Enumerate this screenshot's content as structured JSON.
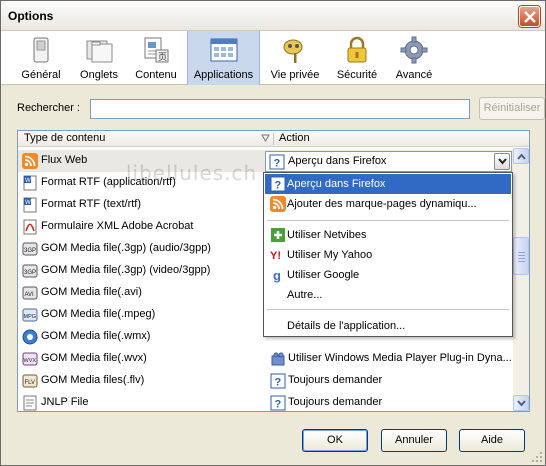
{
  "window": {
    "title": "Options"
  },
  "colors": {
    "selected_tab": "#c9d7ec",
    "highlight": "#316ac5",
    "xp_border": "#003c74"
  },
  "toolbar": {
    "tabs": [
      {
        "label": "Général",
        "icon": "switch-icon"
      },
      {
        "label": "Onglets",
        "icon": "folders-icon"
      },
      {
        "label": "Contenu",
        "icon": "content-page-icon"
      },
      {
        "label": "Applications",
        "icon": "applications-window-icon",
        "selected": true
      },
      {
        "label": "Vie privée",
        "icon": "privacy-mask-icon"
      },
      {
        "label": "Sécurité",
        "icon": "padlock-icon"
      },
      {
        "label": "Avancé",
        "icon": "gear-icon"
      }
    ]
  },
  "search": {
    "label": "Rechercher :",
    "value": "",
    "reset_label": "Réinitialiser"
  },
  "table": {
    "headers": {
      "type": "Type de contenu",
      "action": "Action"
    },
    "rows": [
      {
        "type": "Flux Web",
        "icon": "rss-feed-icon",
        "action": "Aperçu dans Firefox",
        "action_icon": "ask-icon"
      },
      {
        "type": "Format RTF (application/rtf)",
        "icon": "rtf-doc-icon",
        "action": "",
        "action_icon": ""
      },
      {
        "type": "Format RTF (text/rtf)",
        "icon": "rtf-doc-icon",
        "action": "",
        "action_icon": ""
      },
      {
        "type": "Formulaire XML Adobe Acrobat",
        "icon": "pdf-doc-icon",
        "action": "",
        "action_icon": ""
      },
      {
        "type": "GOM Media file(.3gp) (audio/3gpp)",
        "icon": "3gp-media-icon",
        "action": "",
        "action_icon": ""
      },
      {
        "type": "GOM Media file(.3gp) (video/3gpp)",
        "icon": "3gp-media-icon",
        "action": "",
        "action_icon": ""
      },
      {
        "type": "GOM Media file(.avi)",
        "icon": "avi-media-icon",
        "action": "",
        "action_icon": ""
      },
      {
        "type": "GOM Media file(.mpeg)",
        "icon": "mpeg-media-icon",
        "action": "",
        "action_icon": ""
      },
      {
        "type": "GOM Media file(.wmx)",
        "icon": "wmx-media-icon",
        "action": "",
        "action_icon": ""
      },
      {
        "type": "GOM Media file(.wvx)",
        "icon": "wvx-media-icon",
        "action": "Utiliser Windows Media Player Plug-in Dyna...",
        "action_icon": "plugin-icon"
      },
      {
        "type": "GOM Media files(.flv)",
        "icon": "flv-media-icon",
        "action": "Toujours demander",
        "action_icon": "ask-icon"
      },
      {
        "type": "JNLP File",
        "icon": "jnlp-file-icon",
        "action": "Toujours demander",
        "action_icon": "ask-icon"
      }
    ],
    "hidden_row_action": "Toujours demander"
  },
  "dropdown": {
    "items": [
      {
        "label": "Aperçu dans Firefox",
        "icon": "ask-icon",
        "highlighted": true
      },
      {
        "label": "Ajouter des marque-pages dynamiqu...",
        "icon": "rss-feed-icon"
      },
      {
        "label": "Utiliser Netvibes",
        "icon": "netvibes-icon"
      },
      {
        "label": "Utiliser My Yahoo",
        "icon": "yahoo-icon"
      },
      {
        "label": "Utiliser Google",
        "icon": "google-icon"
      },
      {
        "label": "Autre..."
      },
      {
        "label": "Détails de l'application..."
      }
    ]
  },
  "watermark": "libellules.ch",
  "buttons": {
    "ok": "OK",
    "cancel": "Annuler",
    "help": "Aide"
  }
}
